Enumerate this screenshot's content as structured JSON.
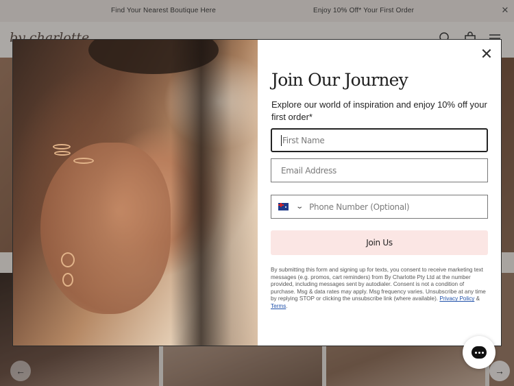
{
  "announcement": {
    "message_left": "Find Your Nearest Boutique Here",
    "message_right": "Enjoy 10% Off* Your First Order",
    "close_icon": "close-icon"
  },
  "header": {
    "logo_text": "by charlotte",
    "icons": [
      "search-icon",
      "bag-icon",
      "menu-icon"
    ]
  },
  "modal": {
    "title": "Join Our Journey",
    "description": "Explore our world of inspiration and enjoy 10% off your first order*",
    "first_name_placeholder": "First Name",
    "email_placeholder": "Email Address",
    "phone_placeholder": "Phone Number (Optional)",
    "country_flag": "AU",
    "join_label": "Join Us",
    "legal_text": "By submitting this form and signing up for texts, you consent to receive marketing text messages (e.g. promos, cart reminders) from By Charlotte Pty Ltd at the number provided, including messages sent by autodialer. Consent is not a condition of purchase. Msg & data rates may apply. Msg frequency varies. Unsubscribe at any time by replying STOP or clicking the unsubscribe link (where available).",
    "privacy_link": "Privacy Policy",
    "amp": "&",
    "terms_link": "Terms",
    "period": ".",
    "close_symbol": "✕"
  },
  "carousel": {
    "prev_symbol": "←",
    "next_symbol": "→"
  },
  "colors": {
    "join_button_bg": "#fbe6e4",
    "link": "#1c4ea8",
    "announcement_bg": "#ebe4df"
  }
}
